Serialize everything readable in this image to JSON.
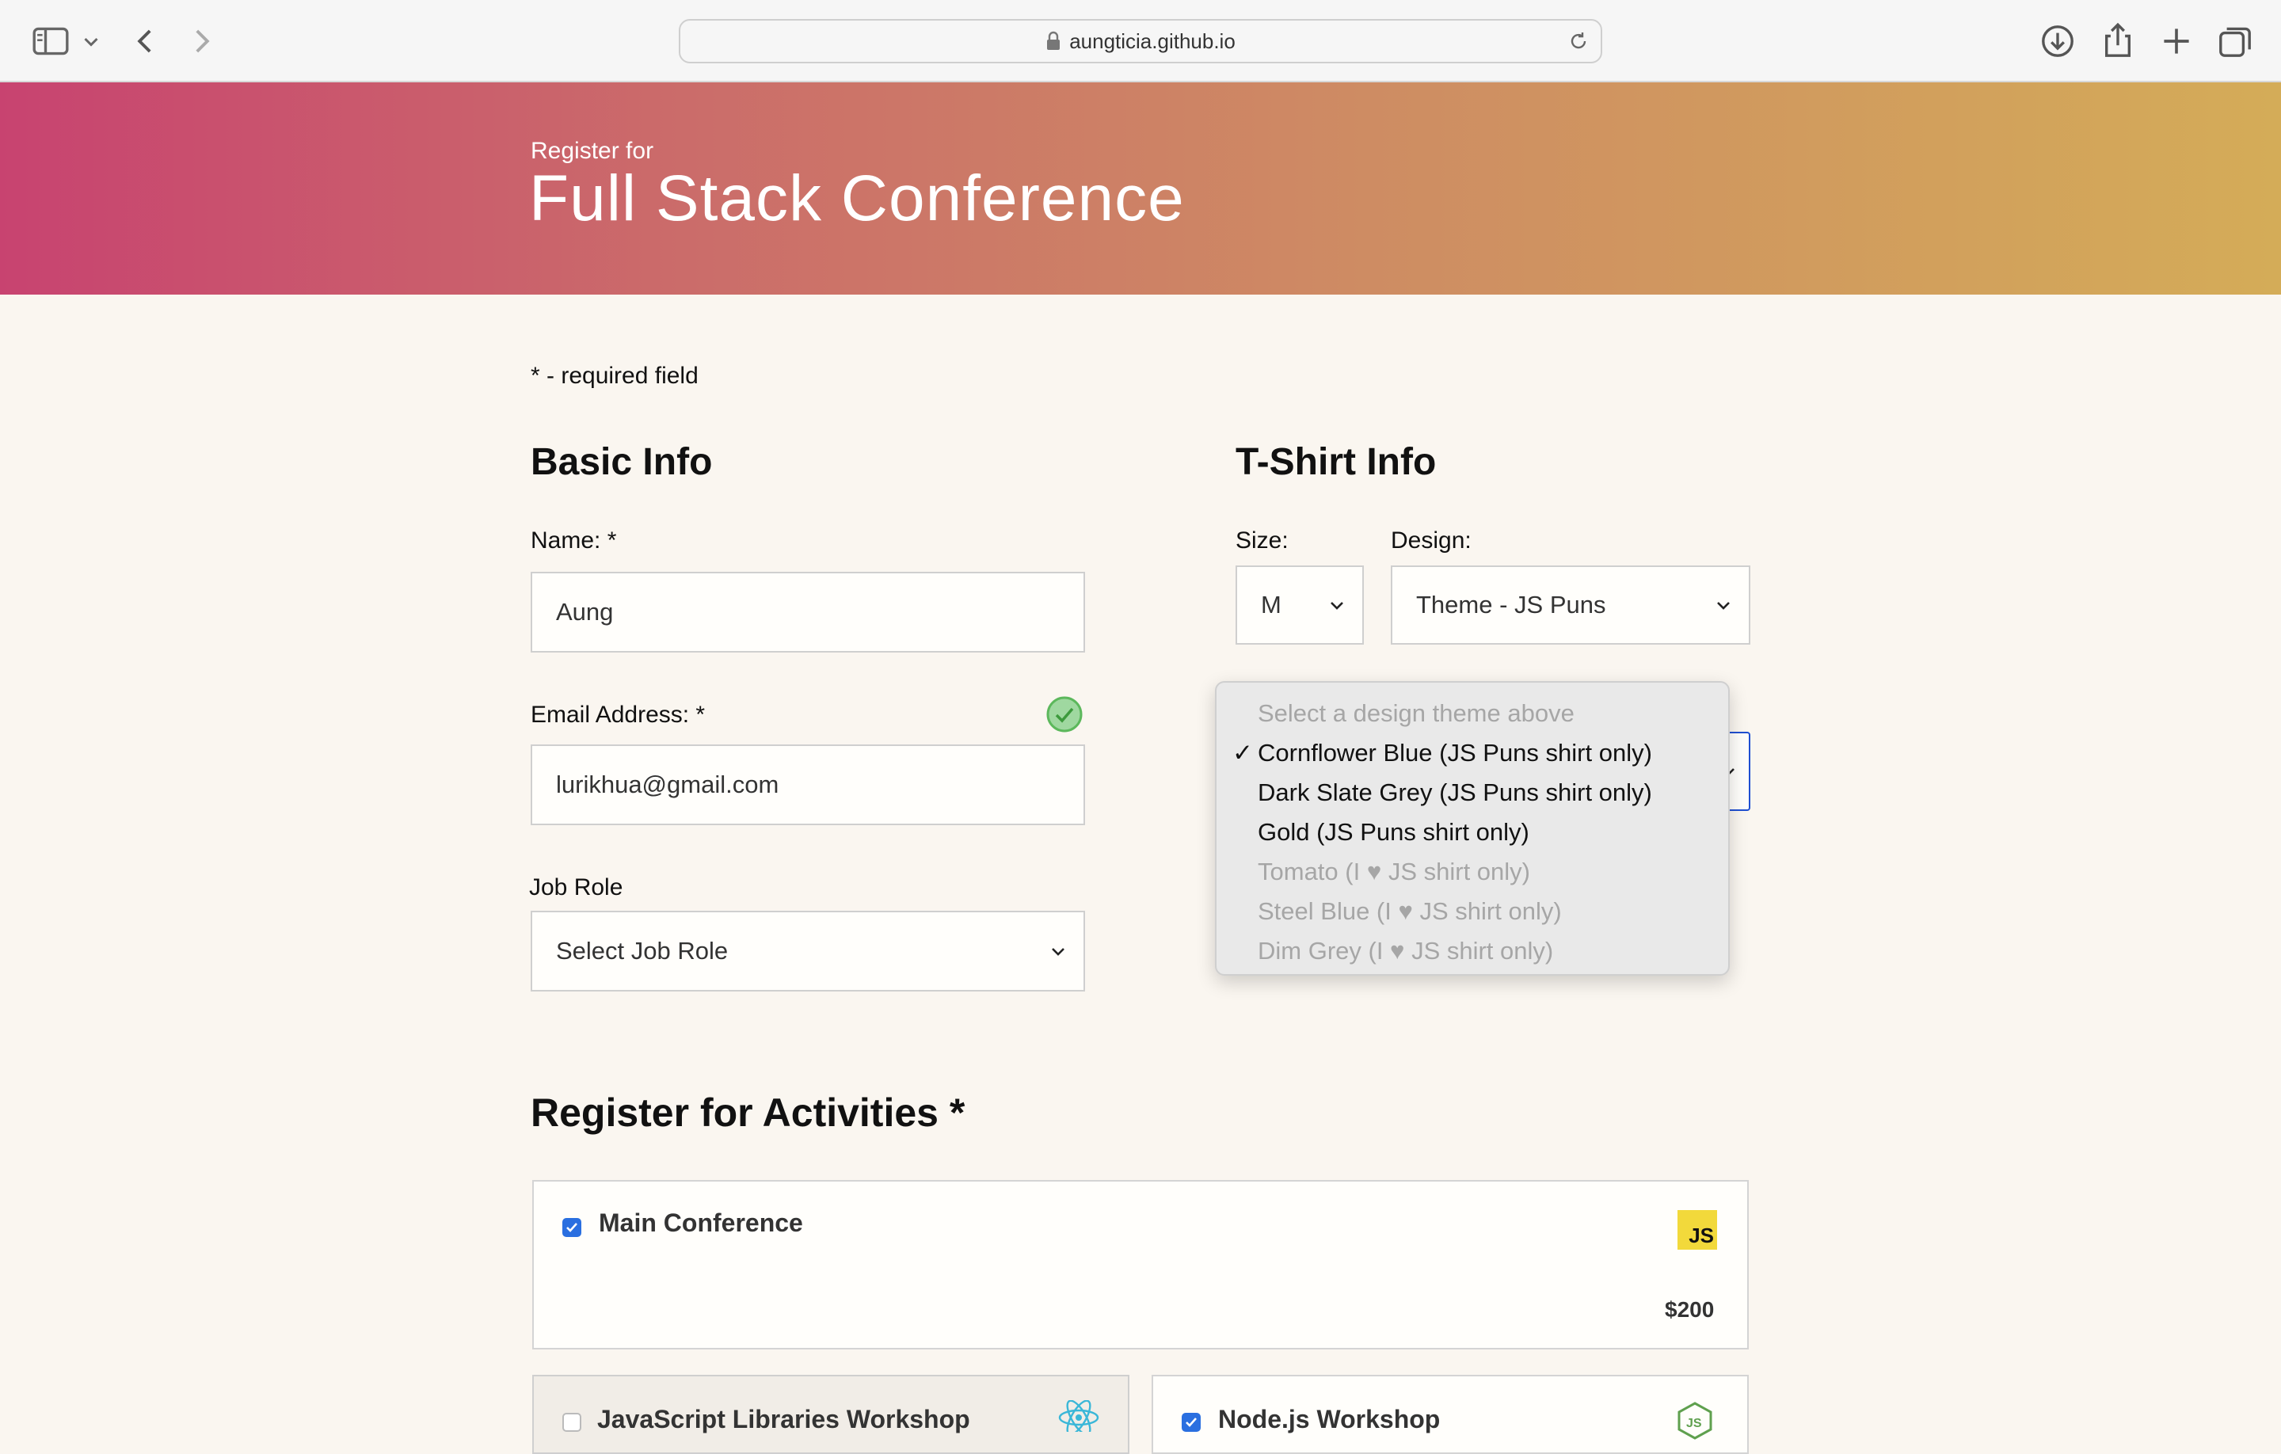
{
  "browser": {
    "url": "aungticia.github.io"
  },
  "header": {
    "pre_title": "Register for",
    "title": "Full Stack Conference"
  },
  "required_note": "* - required field",
  "basic_info": {
    "heading": "Basic Info",
    "name_label": "Name: *",
    "name_value": "Aung",
    "email_label": "Email Address: *",
    "email_value": "lurikhua@gmail.com",
    "job_role_label": "Job Role",
    "job_role_value": "Select Job Role"
  },
  "tshirt_info": {
    "heading": "T-Shirt Info",
    "size_label": "Size:",
    "size_value": "M",
    "design_label": "Design:",
    "design_value": "Theme - JS Puns",
    "color_options": [
      {
        "label": "Select a design theme above",
        "disabled": true,
        "selected": false
      },
      {
        "label": "Cornflower Blue (JS Puns shirt only)",
        "disabled": false,
        "selected": true
      },
      {
        "label": "Dark Slate Grey (JS Puns shirt only)",
        "disabled": false,
        "selected": false
      },
      {
        "label": "Gold (JS Puns shirt only)",
        "disabled": false,
        "selected": false
      },
      {
        "label": "Tomato (I ♥ JS shirt only)",
        "disabled": true,
        "selected": false
      },
      {
        "label": "Steel Blue (I ♥ JS shirt only)",
        "disabled": true,
        "selected": false
      },
      {
        "label": "Dim Grey (I ♥ JS shirt only)",
        "disabled": true,
        "selected": false
      }
    ],
    "checkmark": "✓"
  },
  "activities": {
    "heading": "Register for Activities *",
    "items": [
      {
        "name": "Main Conference",
        "price": "$200",
        "checked": true,
        "icon": "js-icon",
        "badge": "JS"
      },
      {
        "name": "JavaScript Libraries Workshop",
        "checked": false,
        "icon": "react-icon"
      },
      {
        "name": "Node.js Workshop",
        "checked": true,
        "icon": "nodejs-icon"
      }
    ]
  },
  "colors": {
    "accent": "#2a6fe0",
    "valid": "#5cb85c"
  }
}
